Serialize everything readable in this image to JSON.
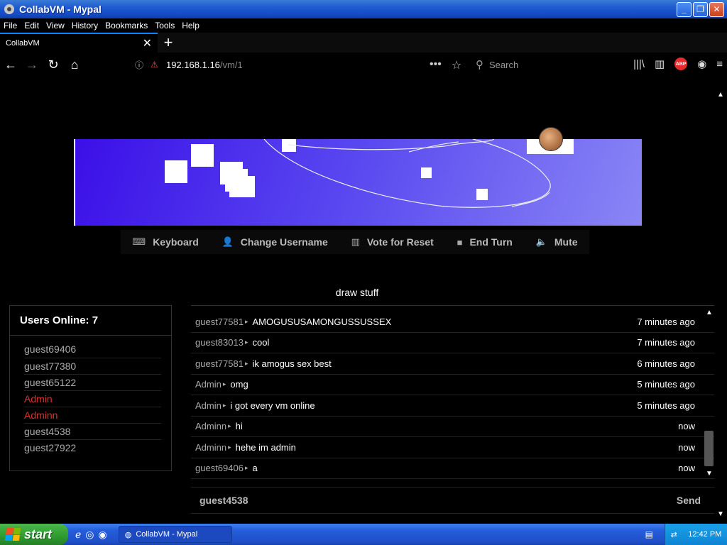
{
  "window": {
    "title": "CollabVM - Mypal",
    "min_icon": "minimize-icon",
    "max_icon": "restore-icon",
    "close_icon": "close-icon"
  },
  "menu": [
    "File",
    "Edit",
    "View",
    "History",
    "Bookmarks",
    "Tools",
    "Help"
  ],
  "tab": {
    "label": "CollabVM",
    "close": "✕",
    "new": "+"
  },
  "nav": {
    "back": "←",
    "forward": "→",
    "reload": "↻",
    "home": "⌂",
    "url_host": "192.168.1.16",
    "url_path": "/vm/1",
    "search_placeholder": "Search"
  },
  "toolbar": {
    "keyboard": "Keyboard",
    "change_username": "Change Username",
    "vote_reset": "Vote for Reset",
    "end_turn": "End Turn",
    "mute": "Mute"
  },
  "motd": "draw stuff",
  "users": {
    "heading": "Users Online: 7",
    "list": [
      {
        "name": "guest69406",
        "admin": false
      },
      {
        "name": "guest77380",
        "admin": false
      },
      {
        "name": "guest65122",
        "admin": false
      },
      {
        "name": "Admin",
        "admin": true
      },
      {
        "name": "Adminn",
        "admin": true
      },
      {
        "name": "guest4538",
        "admin": false
      },
      {
        "name": "guest27922",
        "admin": false
      }
    ]
  },
  "chat": {
    "messages": [
      {
        "user": "guest77581",
        "text": "AMOGUSUSAMONGUSSUSSEX",
        "time": "7 minutes ago"
      },
      {
        "user": "guest83013",
        "text": "cool",
        "time": "7 minutes ago"
      },
      {
        "user": "guest77581",
        "text": "ik amogus sex best",
        "time": "6 minutes ago"
      },
      {
        "user": "Admin",
        "text": "omg",
        "time": "5 minutes ago"
      },
      {
        "user": "Admin",
        "text": "i got every vm online",
        "time": "5 minutes ago"
      },
      {
        "user": "Adminn",
        "text": "hi",
        "time": "now"
      },
      {
        "user": "Adminn",
        "text": "hehe im admin",
        "time": "now"
      },
      {
        "user": "guest69406",
        "text": "a",
        "time": "now"
      }
    ],
    "input_username": "guest4538",
    "input_value": "",
    "send": "Send"
  },
  "taskbar": {
    "start": "start",
    "task": "CollabVM - Mypal",
    "clock": "12:42 PM"
  },
  "colors": {
    "vm_bg_start": "#3b0fe8",
    "vm_bg_end": "#8a86f5",
    "admin": "#e03030",
    "tab_accent": "#0a84ff"
  }
}
